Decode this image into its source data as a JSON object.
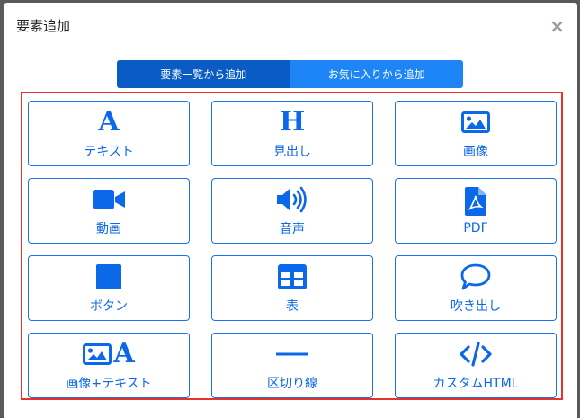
{
  "modal": {
    "title": "要素追加",
    "close_label": "×"
  },
  "tabs": [
    {
      "label": "要素一覧から追加",
      "active": true
    },
    {
      "label": "お気に入りから追加",
      "active": false
    }
  ],
  "tiles": [
    {
      "label": "テキスト",
      "icon": "text-a-icon",
      "glyph": "A"
    },
    {
      "label": "見出し",
      "icon": "heading-h-icon",
      "glyph": "H"
    },
    {
      "label": "画像",
      "icon": "image-icon"
    },
    {
      "label": "動画",
      "icon": "video-camera-icon"
    },
    {
      "label": "音声",
      "icon": "speaker-icon"
    },
    {
      "label": "PDF",
      "icon": "pdf-file-icon"
    },
    {
      "label": "ボタン",
      "icon": "button-square-icon"
    },
    {
      "label": "表",
      "icon": "table-icon"
    },
    {
      "label": "吹き出し",
      "icon": "speech-bubble-icon"
    },
    {
      "label": "画像+テキスト",
      "icon": "image-text-icon",
      "glyph": "A"
    },
    {
      "label": "区切り線",
      "icon": "divider-line-icon"
    },
    {
      "label": "カスタムHTML",
      "icon": "code-icon"
    }
  ],
  "colors": {
    "accent": "#0b68e8",
    "tab_active": "#0a5bc4",
    "tab_inactive": "#1e85f7",
    "highlight_frame": "#e8312b"
  }
}
